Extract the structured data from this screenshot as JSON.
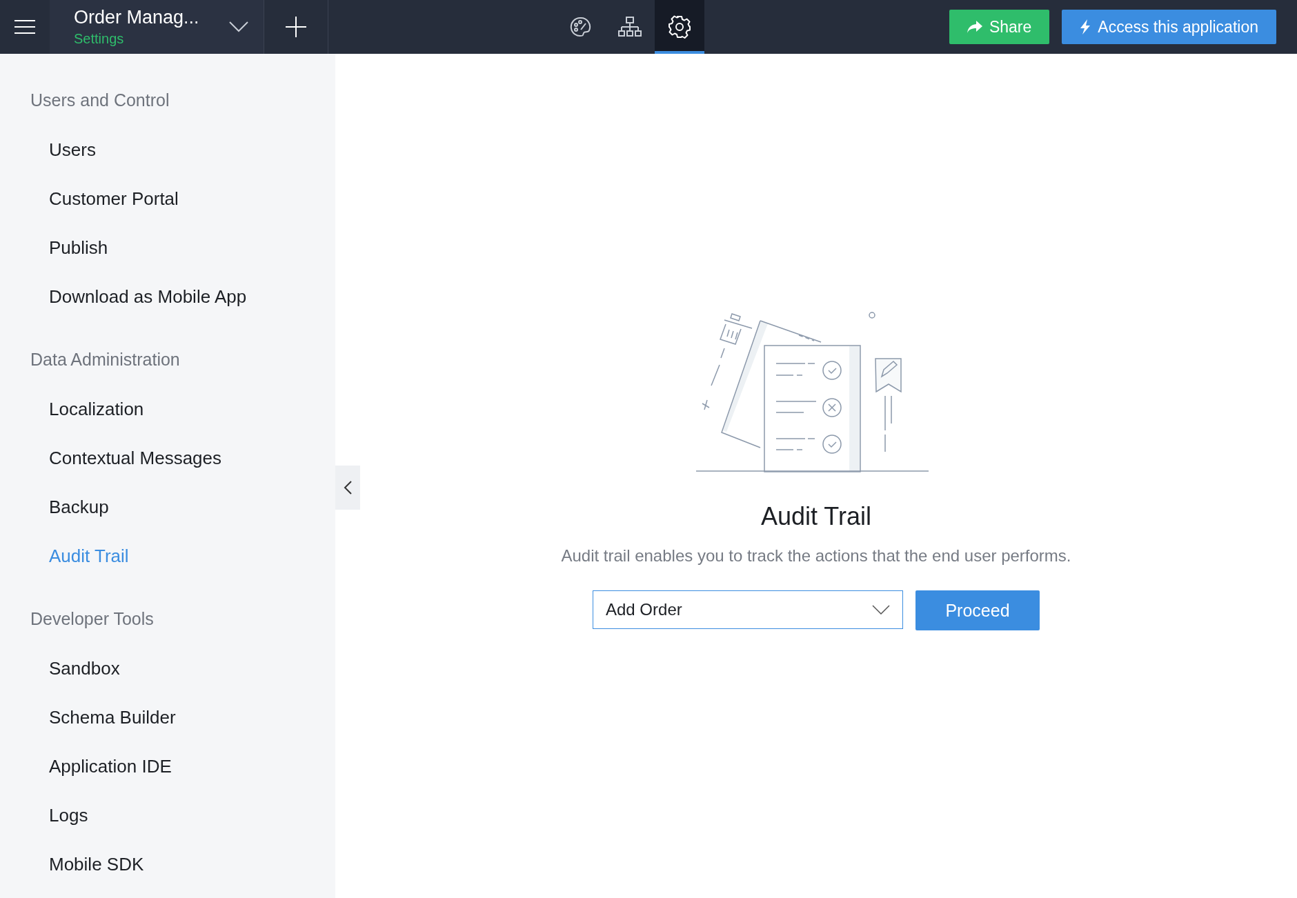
{
  "app_bar": {
    "app_name": "Order Manag...",
    "subtitle": "Settings",
    "tabs": [
      {
        "kind": "palette",
        "selected": false
      },
      {
        "kind": "hierarchy",
        "selected": false
      },
      {
        "kind": "gear",
        "selected": true
      }
    ],
    "buttons": [
      {
        "kind": "share",
        "label": "Share"
      },
      {
        "kind": "access",
        "label": "Access this application"
      }
    ]
  },
  "sidebar": {
    "sections": [
      {
        "title": "Users and Control",
        "items": [
          {
            "label": "Users",
            "selected": false
          },
          {
            "label": "Customer Portal",
            "selected": false
          },
          {
            "label": "Publish",
            "selected": false
          },
          {
            "label": "Download as Mobile App",
            "selected": false
          }
        ]
      },
      {
        "title": "Data Administration",
        "items": [
          {
            "label": "Localization",
            "selected": false
          },
          {
            "label": "Contextual Messages",
            "selected": false
          },
          {
            "label": "Backup",
            "selected": false
          },
          {
            "label": "Audit Trail",
            "selected": true
          }
        ]
      },
      {
        "title": "Developer Tools",
        "items": [
          {
            "label": "Sandbox",
            "selected": false
          },
          {
            "label": "Schema Builder",
            "selected": false
          },
          {
            "label": "Application IDE",
            "selected": false
          },
          {
            "label": "Logs",
            "selected": false
          },
          {
            "label": "Mobile SDK",
            "selected": false
          }
        ]
      }
    ]
  },
  "main": {
    "title": "Audit Trail",
    "description": "Audit trail enables you to track the actions that the end user performs.",
    "dropdown": {
      "value": "Add Order"
    },
    "button": "Proceed"
  }
}
